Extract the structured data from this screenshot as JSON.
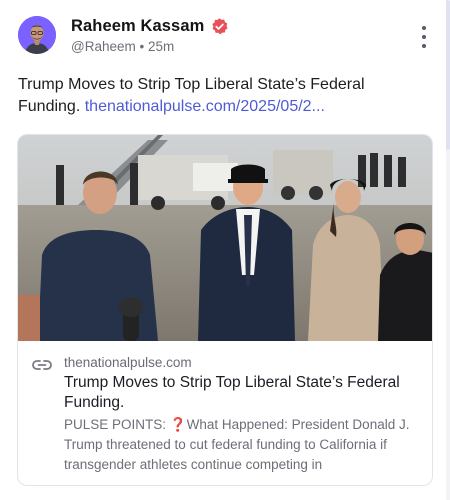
{
  "author": {
    "name": "Raheem Kassam",
    "handle": "@Raheem",
    "separator": "•",
    "time": "25m"
  },
  "post": {
    "text": "Trump Moves to Strip Top Liberal State’s Federal Funding.",
    "link": "thenationalpulse.com/2025/05/2..."
  },
  "card": {
    "image_icon": "photo",
    "domain": "thenationalpulse.com",
    "title": "Trump Moves to Strip Top Liberal State’s Federal Funding.",
    "description": "PULSE POINTS: ❓What Happened: President Donald J. Trump threatened to cut federal funding to California if transgender athletes continue competing in"
  },
  "icons": {
    "verified": "verified-badge-icon",
    "more": "more-vertical-icon",
    "link": "link-icon"
  },
  "colors": {
    "verified_badge": "#e8505b",
    "link": "#4f5bd5",
    "avatar_bg": "#7b61ff"
  }
}
